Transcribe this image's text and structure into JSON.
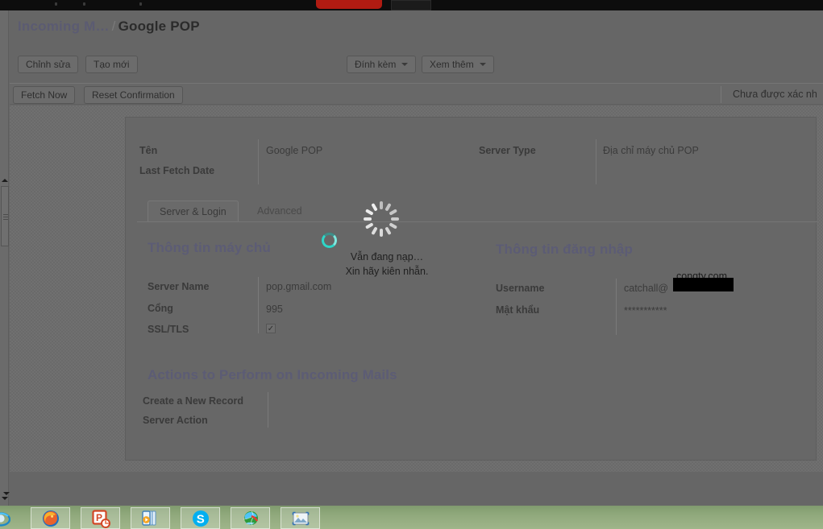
{
  "window": {
    "background_color": "#666666",
    "overlay_dimmed": true
  },
  "breadcrumb": {
    "parent": "Incoming M…",
    "separator": "/",
    "current": "Google POP"
  },
  "toolbar": {
    "edit_label": "Chỉnh sửa",
    "new_label": "Tạo mới",
    "attach_label": "Đính kèm",
    "more_label": "Xem thêm"
  },
  "toolbar2": {
    "fetch_now_label": "Fetch Now",
    "reset_confirmation_label": "Reset Confirmation",
    "status_label": "Chưa được xác nh"
  },
  "record": {
    "name_label": "Tên",
    "name_value": "Google POP",
    "last_fetch_label": "Last Fetch Date",
    "last_fetch_value": "",
    "server_type_label": "Server Type",
    "server_type_value": "Địa chỉ máy chủ POP"
  },
  "tabs": [
    {
      "label": "Server & Login",
      "active": true
    },
    {
      "label": "Advanced",
      "active": false
    }
  ],
  "server_section": {
    "title": "Thông tin máy chủ",
    "fields": [
      {
        "label": "Server Name",
        "value": "pop.gmail.com"
      },
      {
        "label": "Cổng",
        "value": "995"
      },
      {
        "label": "SSL/TLS",
        "value": "✓"
      }
    ]
  },
  "login_section": {
    "title": "Thông tin đăng nhập",
    "annotation": "congty.com",
    "fields": [
      {
        "label": "Username",
        "value": "catchall@"
      },
      {
        "label": "Mật khẩu",
        "value": "***********"
      }
    ]
  },
  "actions_section": {
    "title": "Actions to Perform on Incoming Mails",
    "fields": [
      {
        "label": "Create a New Record",
        "value": ""
      },
      {
        "label": "Server Action",
        "value": ""
      }
    ]
  },
  "loading": {
    "line1": "Vẫn đang nạp…",
    "line2": "Xin hãy kiên nhẫn.",
    "spinner_color": "#2fd6c8",
    "busy_cursor": "busy-spinner-cursor"
  },
  "taskbar": {
    "items": [
      {
        "icon": "internet-explorer-icon"
      },
      {
        "icon": "firefox-icon"
      },
      {
        "icon": "powerpoint-icon"
      },
      {
        "icon": "media-player-icon"
      },
      {
        "icon": "skype-icon"
      },
      {
        "icon": "idm-globe-icon"
      },
      {
        "icon": "photo-viewer-icon"
      }
    ]
  }
}
